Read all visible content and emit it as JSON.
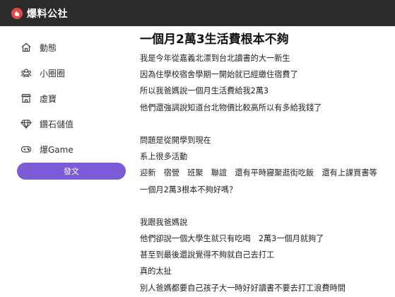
{
  "header": {
    "site_name": "爆料公社",
    "logo_color": "#e24a4a",
    "bar_color": "#2b2b2b"
  },
  "sidebar": {
    "items": [
      {
        "label": "動態",
        "icon": "home-icon"
      },
      {
        "label": "小圈圈",
        "icon": "group-icon"
      },
      {
        "label": "虛寶",
        "icon": "store-icon"
      },
      {
        "label": "鑽石儲值",
        "icon": "diamond-icon"
      },
      {
        "label": "爆Game",
        "icon": "gamepad-icon"
      }
    ],
    "post_button_label": "發文",
    "accent_color": "#7c5bd6"
  },
  "post": {
    "title": "一個月2萬3生活費根本不夠",
    "lines": [
      "我是今年從嘉義北漂到台北讀書的大一新生",
      "因為住學校宿舍學期一開始就已經繳住宿費了",
      "所以我爸媽說一個月生活費給我2萬3",
      "他們還強調說知道台北物價比較高所以有多給我錢了",
      "",
      "問題是從開學到現在",
      "系上很多活動",
      "迎新　宿營　班聚　聯誼　還有平時寢聚逛街吃飯　還有上課買書等",
      "一個月2萬3根本不夠好嗎？",
      "",
      "我跟我爸媽說",
      "他們卻說一個大學生就只有吃喝　2萬3一個月就夠了",
      "甚至到最後還說覺得不夠就自己去打工",
      "真的太扯",
      "別人爸媽都要自己孩子大一時好好讀書不要去打工浪費時間"
    ]
  }
}
